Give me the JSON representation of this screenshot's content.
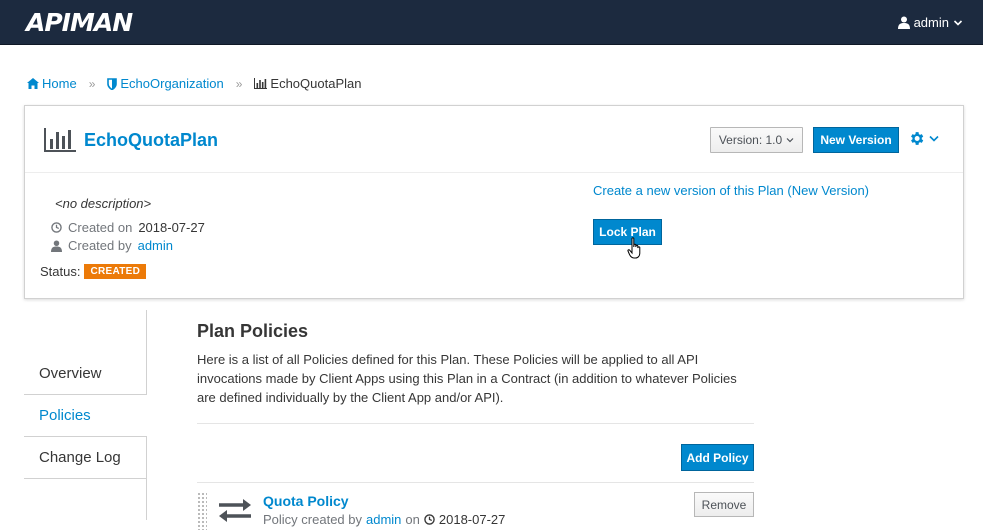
{
  "app": {
    "logo": "APIMAN"
  },
  "user": {
    "name": "admin"
  },
  "breadcrumb": {
    "home": "Home",
    "organization": "EchoOrganization",
    "plan": "EchoQuotaPlan",
    "separator": "»"
  },
  "plan": {
    "title": "EchoQuotaPlan",
    "version_label": "Version: 1.0",
    "new_version_label": "New Version",
    "description": "<no description>",
    "created_on_label": "Created on",
    "created_on": "2018-07-27",
    "created_by_label": "Created by",
    "created_by": "admin",
    "status_label": "Status:",
    "status": "CREATED",
    "create_version_link": "Create a new version of this Plan (New Version)",
    "lock_label": "Lock Plan"
  },
  "sidenav": {
    "items": [
      {
        "label": "Overview"
      },
      {
        "label": "Policies"
      },
      {
        "label": "Change Log"
      }
    ]
  },
  "policies": {
    "title": "Plan Policies",
    "description": "Here is a list of all Policies defined for this Plan. These Policies will be applied to all API invocations made by Client Apps using this Plan in a Contract (in addition to whatever Policies are defined individually by the Client App and/or API).",
    "add_label": "Add Policy",
    "list": [
      {
        "name": "Quota Policy",
        "created_by_prefix": "Policy created by",
        "created_by": "admin",
        "on_label": "on",
        "date": "2018-07-27",
        "remove_label": "Remove"
      }
    ]
  },
  "colors": {
    "topbar": "#1c2a3f",
    "accent": "#0088ce",
    "status_badge": "#ec7a08"
  },
  "icons": {
    "user": "user-icon",
    "home": "home-icon",
    "organization": "shield-icon",
    "plan": "bar-chart-icon",
    "gear": "gear-icon",
    "clock": "clock-icon",
    "policy": "exchange-icon"
  }
}
